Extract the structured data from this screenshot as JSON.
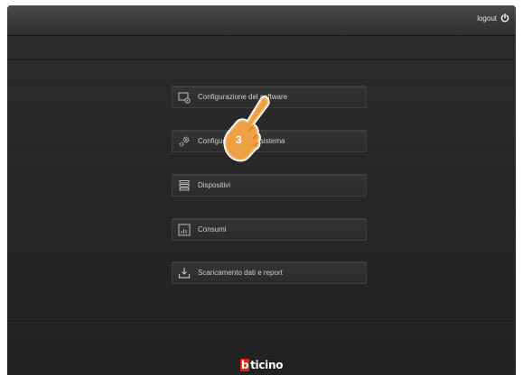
{
  "header": {
    "logout_label": "logout"
  },
  "menu": {
    "items": [
      {
        "label": "Configurazione del software",
        "icon": "monitor-settings-icon"
      },
      {
        "label": "Configurazione del sistema",
        "icon": "gears-icon"
      },
      {
        "label": "Dispositivi",
        "icon": "stack-icon"
      },
      {
        "label": "Consumi",
        "icon": "bar-chart-icon"
      },
      {
        "label": "Scaricamento dati e report",
        "icon": "download-icon"
      }
    ]
  },
  "annotation": {
    "step_number": "3"
  },
  "footer": {
    "brand_b": "b",
    "brand_rest": "ticino"
  },
  "colors": {
    "background": "#262626",
    "text": "#cfcfcf",
    "brand_red": "#e2231a",
    "pointer_orange": "#e8912e"
  }
}
